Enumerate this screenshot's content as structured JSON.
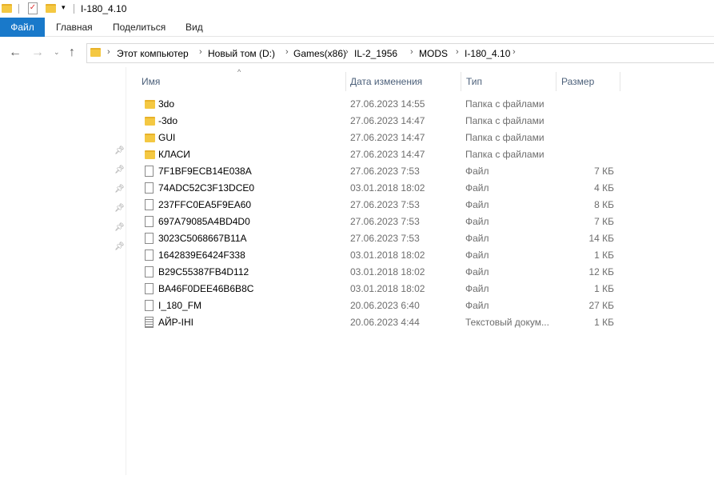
{
  "window": {
    "title": "I-180_4.10"
  },
  "ribbon": {
    "tabs": [
      "Файл",
      "Главная",
      "Поделиться",
      "Вид"
    ]
  },
  "address": {
    "crumbs": [
      "Этот компьютер",
      "Новый том (D:)",
      "Games(x86)",
      "IL-2_1956",
      "MODS",
      "I-180_4.10"
    ]
  },
  "columns": {
    "name": "Имя",
    "date": "Дата изменения",
    "type": "Тип",
    "size": "Размер"
  },
  "files": [
    {
      "name": "3do",
      "date": "27.06.2023 14:55",
      "type": "Папка с файлами",
      "size": "",
      "icon": "folder"
    },
    {
      "name": "-3do",
      "date": "27.06.2023 14:47",
      "type": "Папка с файлами",
      "size": "",
      "icon": "folder"
    },
    {
      "name": "GUI",
      "date": "27.06.2023 14:47",
      "type": "Папка с файлами",
      "size": "",
      "icon": "folder"
    },
    {
      "name": "КЛАСИ",
      "date": "27.06.2023 14:47",
      "type": "Папка с файлами",
      "size": "",
      "icon": "folder"
    },
    {
      "name": "7F1BF9ECB14E038A",
      "date": "27.06.2023 7:53",
      "type": "Файл",
      "size": "7 КБ",
      "icon": "file"
    },
    {
      "name": "74ADC52C3F13DCE0",
      "date": "03.01.2018 18:02",
      "type": "Файл",
      "size": "4 КБ",
      "icon": "file"
    },
    {
      "name": "237FFC0EA5F9EA60",
      "date": "27.06.2023 7:53",
      "type": "Файл",
      "size": "8 КБ",
      "icon": "file"
    },
    {
      "name": "697A79085A4BD4D0",
      "date": "27.06.2023 7:53",
      "type": "Файл",
      "size": "7 КБ",
      "icon": "file"
    },
    {
      "name": "3023C5068667B11A",
      "date": "27.06.2023 7:53",
      "type": "Файл",
      "size": "14 КБ",
      "icon": "file"
    },
    {
      "name": "1642839E6424F338",
      "date": "03.01.2018 18:02",
      "type": "Файл",
      "size": "1 КБ",
      "icon": "file"
    },
    {
      "name": "B29C55387FB4D112",
      "date": "03.01.2018 18:02",
      "type": "Файл",
      "size": "12 КБ",
      "icon": "file"
    },
    {
      "name": "BA46F0DEE46B6B8C",
      "date": "03.01.2018 18:02",
      "type": "Файл",
      "size": "1 КБ",
      "icon": "file"
    },
    {
      "name": "I_180_FM",
      "date": "20.06.2023 6:40",
      "type": "Файл",
      "size": "27 КБ",
      "icon": "file"
    },
    {
      "name": "АЙР-IHI",
      "date": "20.06.2023 4:44",
      "type": "Текстовый докум...",
      "size": "1 КБ",
      "icon": "text"
    }
  ],
  "colors": {
    "accent": "#1979ca",
    "folder": "#f4c842"
  }
}
